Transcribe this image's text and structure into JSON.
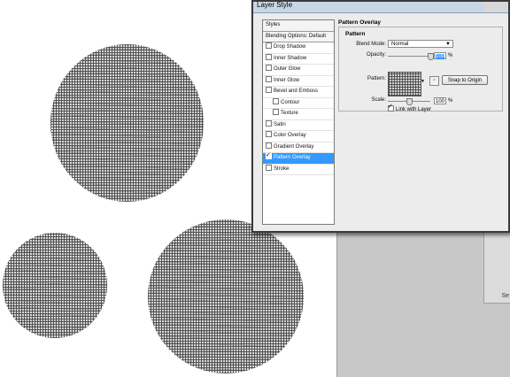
{
  "dialog": {
    "title": "Layer Style"
  },
  "styles_list": {
    "header": "Styles",
    "blending": "Blending Options: Default",
    "items": [
      {
        "label": "Drop Shadow",
        "checked": false
      },
      {
        "label": "Inner Shadow",
        "checked": false
      },
      {
        "label": "Outer Glow",
        "checked": false
      },
      {
        "label": "Inner Glow",
        "checked": false
      },
      {
        "label": "Bevel and Emboss",
        "checked": false
      },
      {
        "label": "Contour",
        "checked": false
      },
      {
        "label": "Texture",
        "checked": false
      },
      {
        "label": "Satin",
        "checked": false
      },
      {
        "label": "Color Overlay",
        "checked": false
      },
      {
        "label": "Gradient Overlay",
        "checked": false
      },
      {
        "label": "Pattern Overlay",
        "checked": true,
        "selected": true
      },
      {
        "label": "Stroke",
        "checked": false
      }
    ]
  },
  "pattern_overlay": {
    "group_title": "Pattern Overlay",
    "sub_title": "Pattern",
    "blend_mode_label": "Blend Mode:",
    "blend_mode_value": "Normal",
    "opacity_label": "Opacity:",
    "opacity_value": "100",
    "opacity_fraction": 1.0,
    "percent": "%",
    "pattern_label": "Pattern:",
    "snap_button": "Snap to Origin",
    "scale_label": "Scale:",
    "scale_value": "100",
    "scale_fraction": 0.5,
    "link_label": "Link with Layer",
    "link_checked": true
  },
  "background_panel": {
    "text": "Se"
  },
  "colors": {
    "selection": "#3399ff",
    "dialog_bg": "#ececec"
  }
}
